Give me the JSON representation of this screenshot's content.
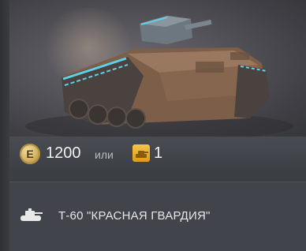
{
  "preview": {
    "image": "tank-render"
  },
  "price": {
    "credits_icon": "credits-coin-icon",
    "credits_symbol": "E",
    "credits_value": "1200",
    "or_label": "или",
    "bond_icon": "tank-token-icon",
    "bond_value": "1"
  },
  "vehicle": {
    "class_icon": "light-tank-icon",
    "name": "Т-60 \"КРАСНАЯ ГВАРДИЯ\""
  },
  "colors": {
    "coin": "#d8b868",
    "bond": "#f3c54a",
    "tracks": "#5fd0e8",
    "hull": "#8a6a52"
  }
}
